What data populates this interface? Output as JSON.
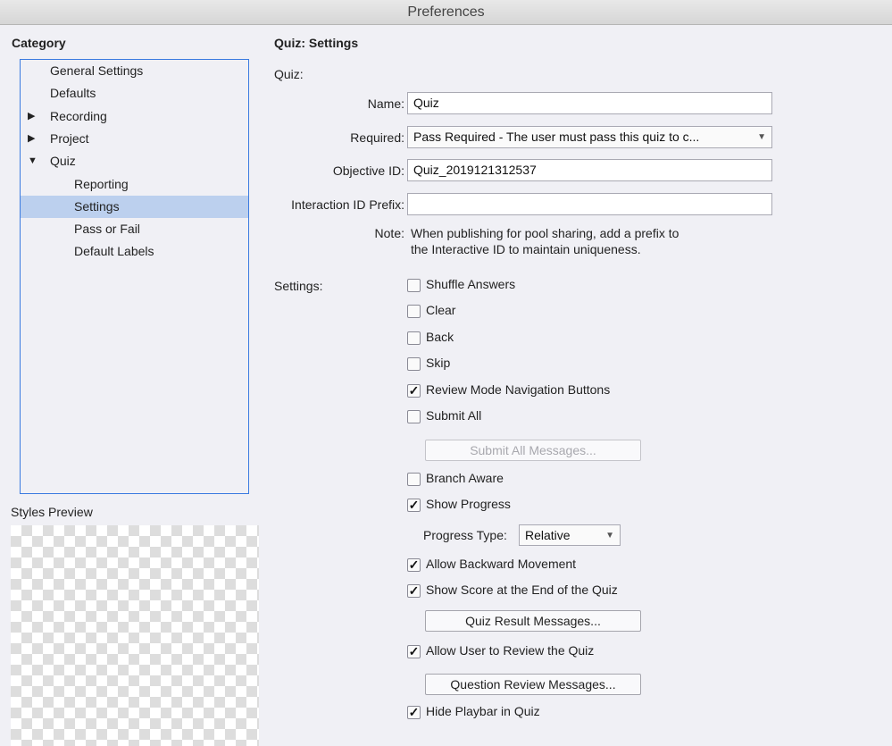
{
  "window": {
    "title": "Preferences"
  },
  "sidebar": {
    "heading": "Category",
    "items": [
      {
        "label": "General Settings",
        "level": 0,
        "expander": ""
      },
      {
        "label": "Defaults",
        "level": 0,
        "expander": ""
      },
      {
        "label": "Recording",
        "level": 0,
        "expander": "▶"
      },
      {
        "label": "Project",
        "level": 0,
        "expander": "▶"
      },
      {
        "label": "Quiz",
        "level": 0,
        "expander": "▼"
      },
      {
        "label": "Reporting",
        "level": 1,
        "expander": ""
      },
      {
        "label": "Settings",
        "level": 1,
        "expander": "",
        "selected": true
      },
      {
        "label": "Pass or Fail",
        "level": 1,
        "expander": ""
      },
      {
        "label": "Default Labels",
        "level": 1,
        "expander": ""
      }
    ],
    "styles_preview": "Styles Preview"
  },
  "main": {
    "heading": "Quiz: Settings",
    "quiz_label": "Quiz:",
    "name": {
      "label": "Name:",
      "value": "Quiz"
    },
    "required": {
      "label": "Required:",
      "value": "Pass Required - The user must pass this quiz to c..."
    },
    "objective": {
      "label": "Objective ID:",
      "value": "Quiz_2019121312537"
    },
    "interaction": {
      "label": "Interaction ID Prefix:",
      "value": ""
    },
    "note": {
      "label": "Note:",
      "line1": "When publishing for pool sharing, add a prefix to",
      "line2": "the Interactive ID to maintain uniqueness."
    },
    "settings_label": "Settings:",
    "checks": [
      {
        "label": "Shuffle Answers",
        "checked": false
      },
      {
        "label": "Clear",
        "checked": false
      },
      {
        "label": "Back",
        "checked": false
      },
      {
        "label": "Skip",
        "checked": false
      },
      {
        "label": "Review Mode Navigation Buttons",
        "checked": true
      },
      {
        "label": "Submit All",
        "checked": false
      },
      {
        "label": "Branch Aware",
        "checked": false
      },
      {
        "label": "Show Progress",
        "checked": true
      },
      {
        "label": "Allow Backward Movement",
        "checked": true
      },
      {
        "label": "Show Score at the End of the Quiz",
        "checked": true
      },
      {
        "label": "Allow User to Review the Quiz",
        "checked": true
      },
      {
        "label": "Hide Playbar in Quiz",
        "checked": true
      }
    ],
    "submit_all_messages": "Submit All Messages...",
    "progress_type": {
      "label": "Progress Type:",
      "value": "Relative"
    },
    "quiz_result_messages": "Quiz Result Messages...",
    "question_review_messages": "Question Review Messages..."
  }
}
